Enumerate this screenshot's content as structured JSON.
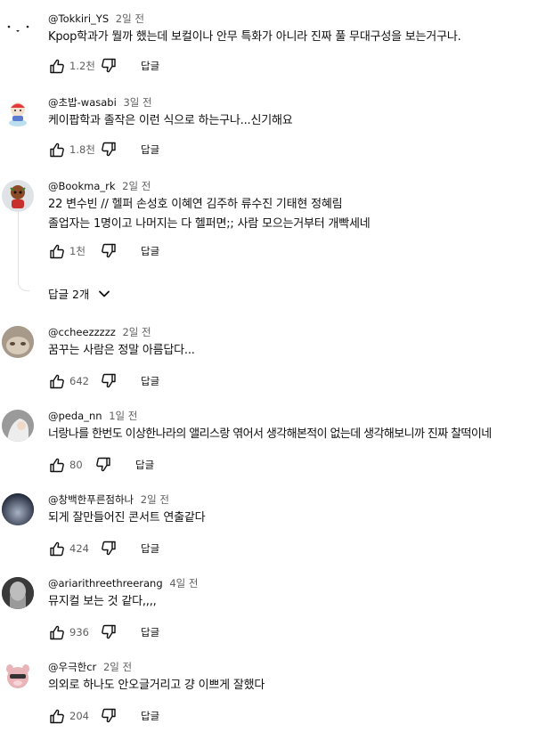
{
  "comments": [
    {
      "handle": "@Tokkiri_YS",
      "time": "2일 전",
      "text": "Kpop학과가 뭘까 했는데 보컬이나 안무 특화가 아니라 진짜 풀 무대구성을 보는거구나.",
      "likes": "1.2천",
      "reply": "답글"
    },
    {
      "handle": "@초밥-wasabi",
      "time": "3일 전",
      "text": "케이팝학과 졸작은 이런 식으로 하는구나...신기해요",
      "likes": "1.8천",
      "reply": "답글"
    },
    {
      "handle": "@Bookma_rk",
      "time": "2일 전",
      "text": "22 변수빈 // 헬퍼 손성호 이혜연 김주하 류수진 기태현 정혜림",
      "text2": "졸업자는 1명이고 나머지는 다 헬퍼면;; 사람 모으는거부터 개빡세네",
      "likes": "1천",
      "reply": "답글",
      "replies_label": "답글 2개"
    },
    {
      "handle": "@ccheezzzzz",
      "time": "2일 전",
      "text": "꿈꾸는 사람은 정말 아름답다...",
      "likes": "642",
      "reply": "답글"
    },
    {
      "handle": "@peda_nn",
      "time": "1일 전",
      "text": "너랑나를 한번도 이상한나라의 앨리스랑 엮어서 생각해본적이 없는데 생각해보니까 진짜 찰떡이네",
      "likes": "80",
      "reply": "답글"
    },
    {
      "handle": "@창백한푸른점하나",
      "time": "2일 전",
      "text": "되게 잘만들어진 콘서트 연출같다",
      "likes": "424",
      "reply": "답글"
    },
    {
      "handle": "@ariarithreethreerang",
      "time": "4일 전",
      "text": "뮤지컬 보는 것 같다,,,,",
      "likes": "936",
      "reply": "답글"
    },
    {
      "handle": "@우극한cr",
      "time": "2일 전",
      "text": "의외로 하나도 안오글거리고 걍 이쁘게 잘했다",
      "likes": "204",
      "reply": "답글"
    }
  ],
  "icons": {
    "like": "thumb-up-icon",
    "dislike": "thumb-down-icon",
    "expand": "chevron-down-icon"
  }
}
